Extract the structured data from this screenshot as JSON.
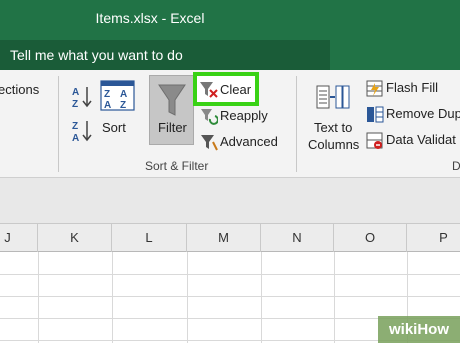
{
  "window": {
    "title": "Items.xlsx  -  Excel"
  },
  "tell_me": {
    "placeholder": "Tell me what you want to do"
  },
  "ribbon": {
    "left_cut_label": "ections",
    "sort_label": "Sort",
    "filter_label": "Filter",
    "clear_label": "Clear",
    "reapply_label": "Reapply",
    "advanced_label": "Advanced",
    "group_label": "Sort & Filter",
    "text_to_columns_line1": "Text to",
    "text_to_columns_line2": "Columns",
    "flash_fill_label": "Flash Fill",
    "remove_dup_label": "Remove Dup",
    "data_validation_label": "Data Validat",
    "group_right_cut": "D"
  },
  "columns": [
    "J",
    "K",
    "L",
    "M",
    "N",
    "O",
    "P"
  ],
  "watermark": "wikiHow",
  "colors": {
    "excel_green": "#217346",
    "highlight": "#39d215"
  }
}
